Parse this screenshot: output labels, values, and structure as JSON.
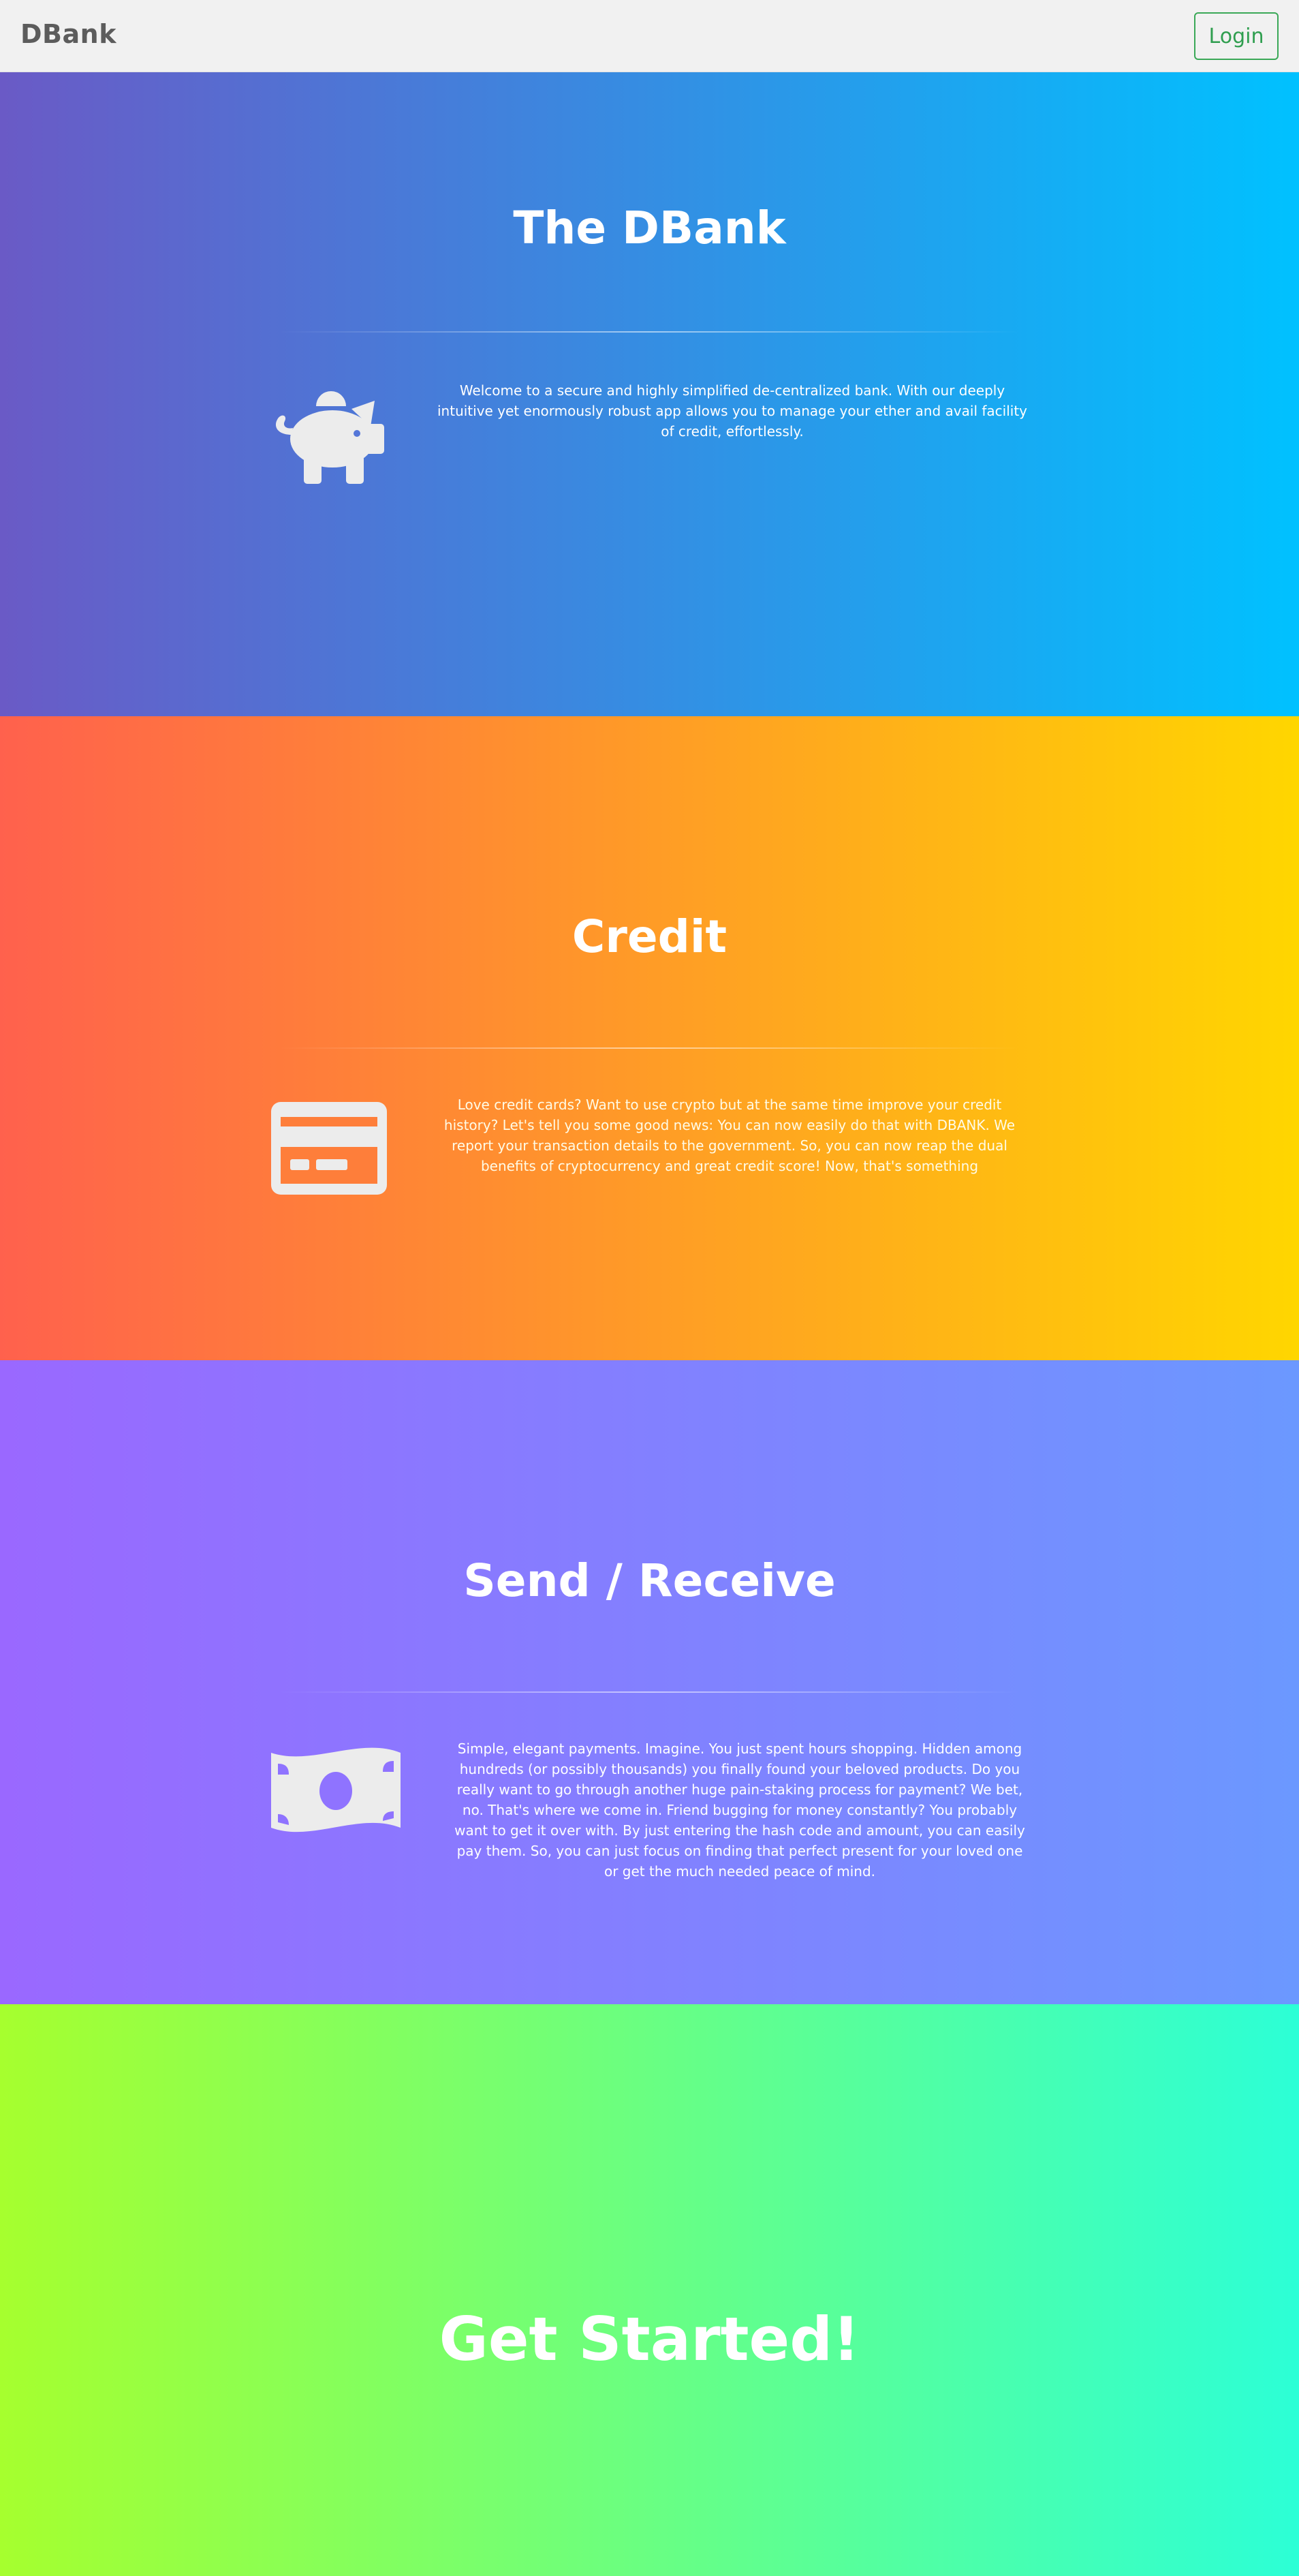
{
  "navbar": {
    "brand": "DBank",
    "login_label": "Login"
  },
  "sections": {
    "home": {
      "title": "The DBank",
      "text": "Welcome to a secure and highly simplified de-centralized bank. With our deeply intuitive yet enormously robust app allows you to manage your ether and avail facility of credit, effortlessly.",
      "icon": "piggy-bank-icon"
    },
    "credit": {
      "title": "Credit",
      "text": "Love credit cards? Want to use crypto but at the same time improve your credit history? Let's tell you some good news: You can now easily do that with DBANK. We report your transaction details to the government. So, you can now reap the dual benefits of cryptocurrency and great credit score! Now, that's something",
      "icon": "credit-card-icon"
    },
    "send": {
      "title": "Send / Receive",
      "text": "Simple, elegant payments. Imagine. You just spent hours shopping. Hidden among hundreds (or possibly thousands) you finally found your beloved products. Do you really want to go through another huge pain-staking process for payment? We bet, no. That's where we come in. Friend bugging for money constantly? You probably want to get it over with. By just entering the hash code and amount, you can easily pay them. So, you can just focus on finding that perfect present for your loved one or get the much needed peace of mind.",
      "icon": "money-bill-icon"
    },
    "start": {
      "title": "Get Started!"
    }
  },
  "colors": {
    "home_gradient": [
      "#6a5ac6",
      "#00c1ff"
    ],
    "credit_gradient": [
      "#ff614d",
      "#ffd600"
    ],
    "send_gradient": [
      "#9a68ff",
      "#6b98ff"
    ],
    "start_gradient": [
      "#a6ff2e",
      "#2cffd6"
    ],
    "login_accent": "#2f9e4f",
    "icon_fill": "#ececec"
  }
}
